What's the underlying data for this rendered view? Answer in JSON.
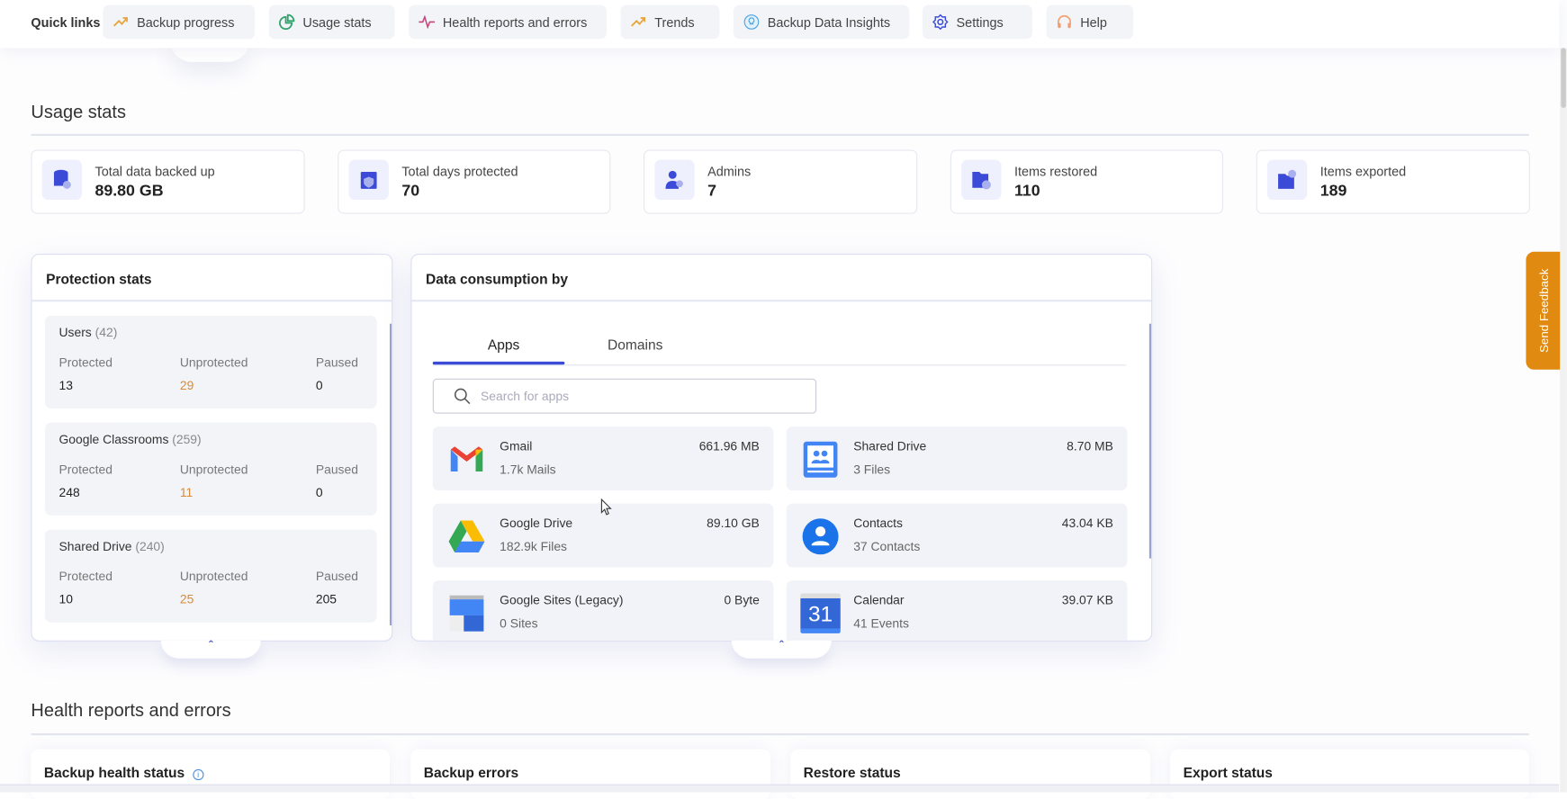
{
  "quick_links": {
    "label": "Quick links",
    "items": [
      {
        "label": "Backup progress",
        "icon": "trend-up-icon",
        "color": "#e8a33a"
      },
      {
        "label": "Usage stats",
        "icon": "pie-chart-icon",
        "color": "#2ea36b"
      },
      {
        "label": "Health reports and errors",
        "icon": "pulse-icon",
        "color": "#c2477a"
      },
      {
        "label": "Trends",
        "icon": "trend-up-icon",
        "color": "#e8a33a"
      },
      {
        "label": "Backup Data Insights",
        "icon": "lightbulb-icon",
        "color": "#4aa3e0"
      },
      {
        "label": "Settings",
        "icon": "gear-icon",
        "color": "#3b4bd8"
      },
      {
        "label": "Help",
        "icon": "headset-icon",
        "color": "#f0a070"
      }
    ]
  },
  "usage": {
    "title": "Usage stats",
    "stats": [
      {
        "label": "Total data backed up",
        "value": "89.80 GB",
        "icon": "database-icon"
      },
      {
        "label": "Total days protected",
        "value": "70",
        "icon": "calendar-shield-icon"
      },
      {
        "label": "Admins",
        "value": "7",
        "icon": "admin-user-icon"
      },
      {
        "label": "Items restored",
        "value": "110",
        "icon": "folder-restore-icon"
      },
      {
        "label": "Items exported",
        "value": "189",
        "icon": "folder-export-icon"
      }
    ]
  },
  "protection": {
    "title": "Protection stats",
    "col_labels": [
      "Protected",
      "Unprotected",
      "Paused"
    ],
    "groups": [
      {
        "name": "Users",
        "count": "(42)",
        "values": [
          "13",
          "29",
          "0"
        ]
      },
      {
        "name": "Google Classrooms",
        "count": "(259)",
        "values": [
          "248",
          "11",
          "0"
        ]
      },
      {
        "name": "Shared Drive",
        "count": "(240)",
        "values": [
          "10",
          "25",
          "205"
        ]
      }
    ]
  },
  "consumption": {
    "title": "Data consumption by",
    "tabs": [
      "Apps",
      "Domains"
    ],
    "active_tab": "Apps",
    "search_placeholder": "Search for apps",
    "apps": [
      {
        "name": "Gmail",
        "sub": "1.7k Mails",
        "size": "661.96 MB"
      },
      {
        "name": "Shared Drive",
        "sub": "3 Files",
        "size": "8.70 MB"
      },
      {
        "name": "Google Drive",
        "sub": "182.9k Files",
        "size": "89.10 GB"
      },
      {
        "name": "Contacts",
        "sub": "37 Contacts",
        "size": "43.04 KB"
      },
      {
        "name": "Google Sites (Legacy)",
        "sub": "0 Sites",
        "size": "0 Byte"
      },
      {
        "name": "Calendar",
        "sub": "41 Events",
        "size": "39.07 KB",
        "icon_text": "31"
      }
    ]
  },
  "health": {
    "title": "Health reports and errors",
    "cards": [
      "Backup health status",
      "Backup errors",
      "Restore status",
      "Export status"
    ]
  },
  "feedback": {
    "label": "Send Feedback",
    "color": "#e08a12"
  },
  "colors": {
    "accent": "#3b4bd8",
    "unprotected": "#d88a3a"
  }
}
